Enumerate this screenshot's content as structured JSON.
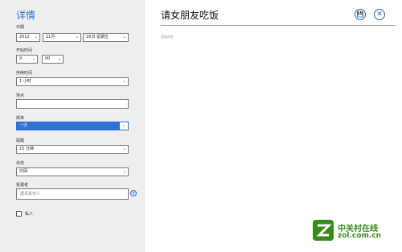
{
  "details": {
    "title": "详情",
    "date_label": "日期",
    "year": "2012",
    "month": "11月",
    "day": "16日 星期五",
    "start_time_label": "开始时间",
    "start_hour": "9",
    "start_minute": "00",
    "duration_label": "持续时间",
    "duration": "1 小时",
    "location_label": "地点",
    "location_value": "",
    "frequency_label": "频率",
    "frequency": "一次",
    "reminder_label": "提醒",
    "reminder": "15 分钟",
    "status_label": "状态",
    "status": "忙碌",
    "attendees_label": "受邀者",
    "attendees_placeholder": "邀请其他人",
    "private_label": "私人"
  },
  "event": {
    "title": "请女朋友吃饭",
    "notes_placeholder": "添加消息"
  },
  "watermark": {
    "brand": "中关村在线",
    "url": "zol.com.cn"
  },
  "colors": {
    "accent": "#2e72d2",
    "sidebar_bg": "#eeeeee",
    "watermark": "#3a8a1e"
  }
}
